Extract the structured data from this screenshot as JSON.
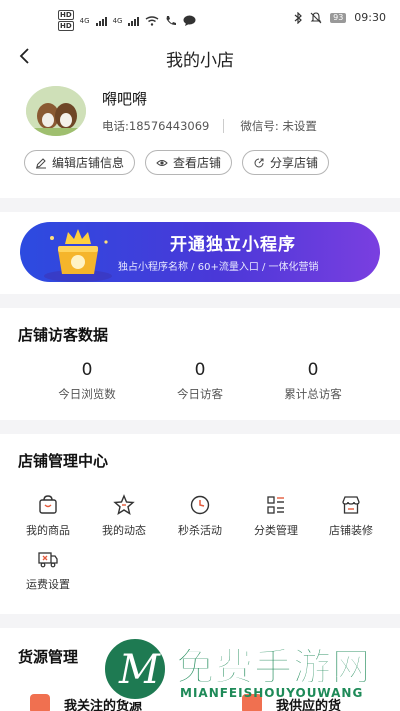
{
  "statusbar": {
    "time": "09:30",
    "battery": "93",
    "net1": "HD",
    "net2": "HD",
    "sig1": "4G",
    "sig2": "4G"
  },
  "nav": {
    "title": "我的小店"
  },
  "profile": {
    "name": "嘚吧嘚",
    "phone": "电话:18576443069",
    "wechat": "微信号: 未设置",
    "actions": [
      "编辑店铺信息",
      "查看店铺",
      "分享店铺"
    ]
  },
  "banner": {
    "title": "开通独立小程序",
    "subtitle": "独占小程序名称 / 60+流量入口 / 一体化营销"
  },
  "visitors": {
    "title": "店铺访客数据",
    "stats": [
      {
        "value": "0",
        "label": "今日浏览数"
      },
      {
        "value": "0",
        "label": "今日访客"
      },
      {
        "value": "0",
        "label": "累计总访客"
      }
    ]
  },
  "management": {
    "title": "店铺管理中心",
    "tools": [
      {
        "label": "我的商品",
        "icon": "bag-icon"
      },
      {
        "label": "我的动态",
        "icon": "star-icon"
      },
      {
        "label": "秒杀活动",
        "icon": "clock-icon"
      },
      {
        "label": "分类管理",
        "icon": "list-icon"
      },
      {
        "label": "店铺装修",
        "icon": "storefront-icon"
      },
      {
        "label": "运费设置",
        "icon": "truck-icon"
      }
    ]
  },
  "supply": {
    "title": "货源管理",
    "items": [
      {
        "label": "我关注的货源"
      },
      {
        "label": "我供应的货"
      }
    ]
  },
  "watermark": {
    "text": "免费手游网",
    "url": "MIANFEISHOUYOUWANG"
  },
  "colors": {
    "accent": "#4a38d8",
    "watermark": "#1e8a58"
  }
}
